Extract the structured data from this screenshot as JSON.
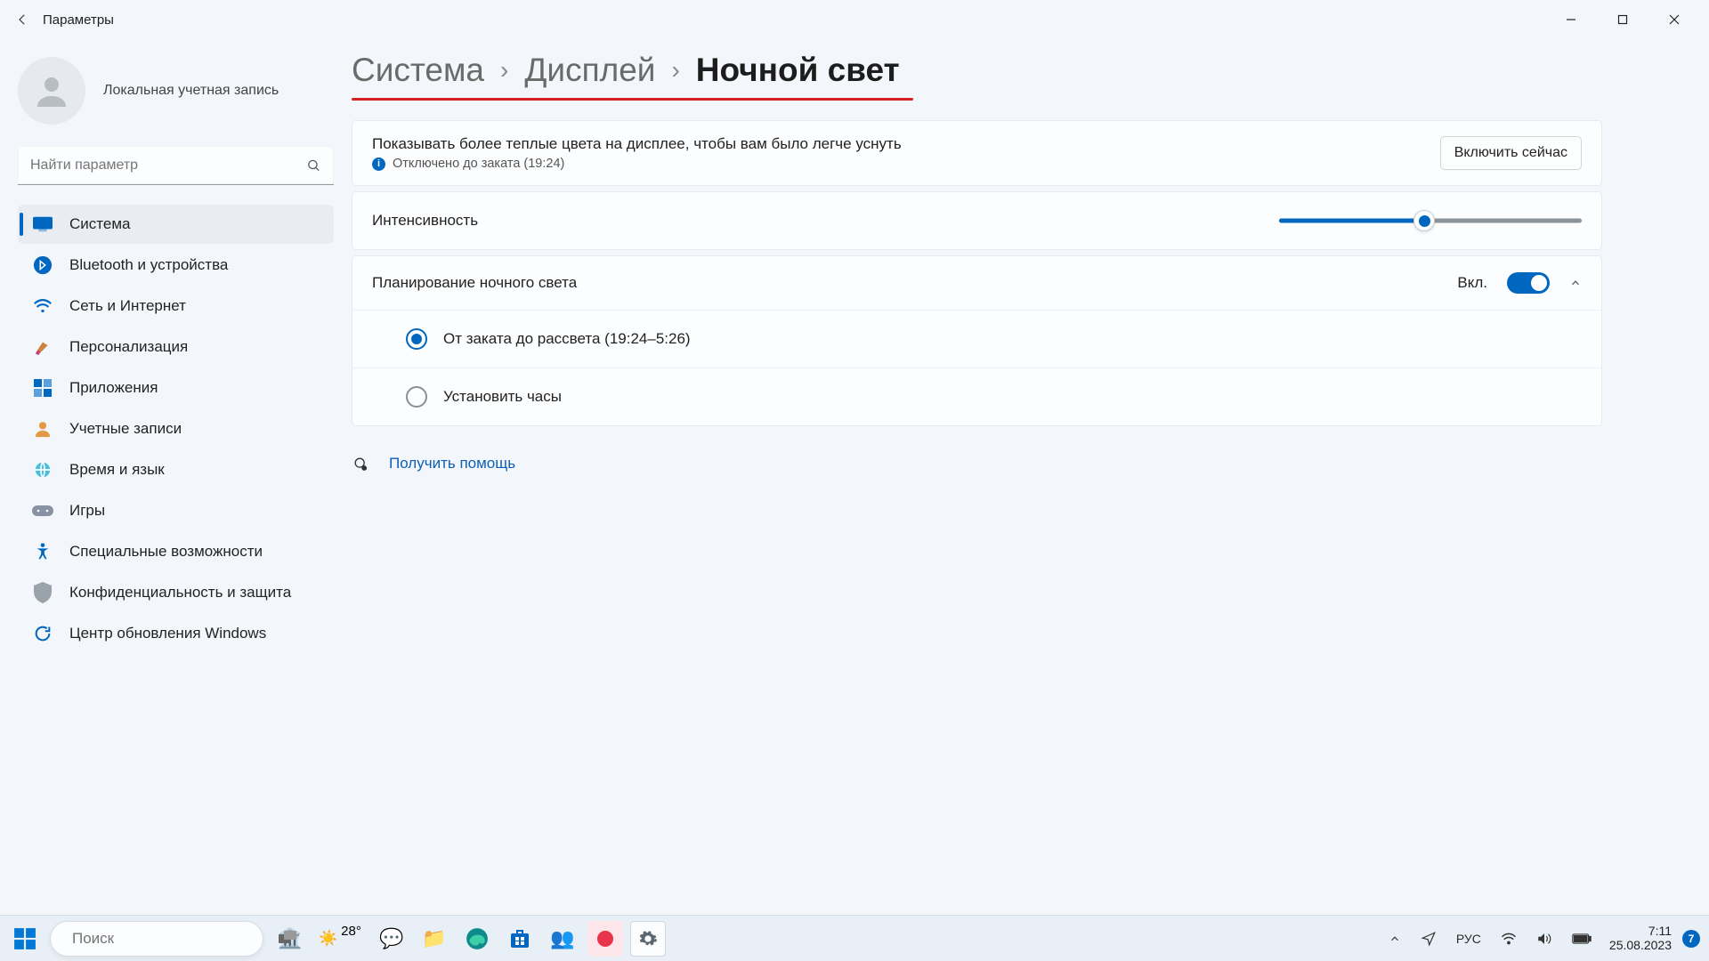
{
  "titlebar": {
    "app_name": "Параметры"
  },
  "account": {
    "label": "Локальная учетная запись"
  },
  "search": {
    "placeholder": "Найти параметр"
  },
  "sidebar": {
    "items": [
      {
        "label": "Система",
        "icon": "system",
        "active": true
      },
      {
        "label": "Bluetooth и устройства",
        "icon": "bluetooth"
      },
      {
        "label": "Сеть и Интернет",
        "icon": "wifi"
      },
      {
        "label": "Персонализация",
        "icon": "brush"
      },
      {
        "label": "Приложения",
        "icon": "apps"
      },
      {
        "label": "Учетные записи",
        "icon": "person"
      },
      {
        "label": "Время и язык",
        "icon": "globe"
      },
      {
        "label": "Игры",
        "icon": "gamepad"
      },
      {
        "label": "Специальные возможности",
        "icon": "accessibility"
      },
      {
        "label": "Конфиденциальность и защита",
        "icon": "shield"
      },
      {
        "label": "Центр обновления Windows",
        "icon": "update"
      }
    ]
  },
  "breadcrumb": {
    "p1": "Система",
    "p2": "Дисплей",
    "p3": "Ночной свет"
  },
  "card1": {
    "title": "Показывать более теплые цвета на дисплее, чтобы вам было легче уснуть",
    "status": "Отключено до заката (19:24)",
    "button": "Включить сейчас"
  },
  "intensity": {
    "label": "Интенсивность",
    "value": 48
  },
  "schedule": {
    "label": "Планирование ночного света",
    "state": "Вкл.",
    "opt1": "От заката до рассвета (19:24–5:26)",
    "opt2": "Установить часы"
  },
  "help": {
    "link": "Получить помощь"
  },
  "taskbar": {
    "search_placeholder": "Поиск",
    "weather_temp": "28°",
    "lang": "РУС",
    "time": "7:11",
    "date": "25.08.2023",
    "notif_count": "7"
  }
}
